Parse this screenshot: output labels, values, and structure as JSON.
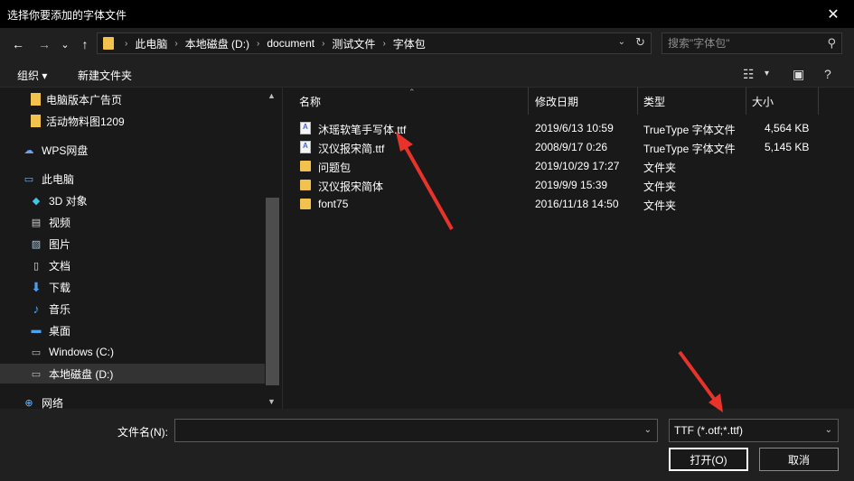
{
  "window": {
    "title": "选择你要添加的字体文件",
    "close_glyph": "✕"
  },
  "nav": {
    "back_glyph": "←",
    "forward_glyph": "→",
    "recent_glyph": "⌄",
    "up_glyph": "↑",
    "breadcrumbs": [
      "此电脑",
      "本地磁盘 (D:)",
      "document",
      "测试文件",
      "字体包"
    ],
    "search_placeholder": "搜索\"字体包\""
  },
  "toolbar": {
    "organize": "组织 ▾",
    "new_folder": "新建文件夹"
  },
  "sidebar": {
    "items": [
      {
        "label": "电脑版本广告页",
        "icon": "folder-icon",
        "indent": 1
      },
      {
        "label": "活动物料图1209",
        "icon": "folder-icon",
        "indent": 1
      },
      {
        "label": "WPS网盘",
        "icon": "cloud-icon",
        "indent": 0
      },
      {
        "label": "此电脑",
        "icon": "computer-icon",
        "indent": 0
      },
      {
        "label": "3D 对象",
        "icon": "cube-icon",
        "indent": 1
      },
      {
        "label": "视频",
        "icon": "video-icon",
        "indent": 1
      },
      {
        "label": "图片",
        "icon": "picture-icon",
        "indent": 1
      },
      {
        "label": "文档",
        "icon": "document-icon",
        "indent": 1
      },
      {
        "label": "下载",
        "icon": "download-icon",
        "indent": 1
      },
      {
        "label": "音乐",
        "icon": "music-icon",
        "indent": 1
      },
      {
        "label": "桌面",
        "icon": "desktop-icon",
        "indent": 1
      },
      {
        "label": "Windows (C:)",
        "icon": "drive-icon",
        "indent": 1
      },
      {
        "label": "本地磁盘 (D:)",
        "icon": "drive-icon",
        "indent": 1
      },
      {
        "label": "网络",
        "icon": "network-icon",
        "indent": 0
      }
    ]
  },
  "files": {
    "columns": {
      "name": "名称",
      "modified": "修改日期",
      "type": "类型",
      "size": "大小"
    },
    "rows": [
      {
        "name": "沐瑶软笔手写体.ttf",
        "modified": "2019/6/13 10:59",
        "type": "TrueType 字体文件",
        "size": "4,564 KB",
        "kind": "ttf"
      },
      {
        "name": "汉仪报宋简.ttf",
        "modified": "2008/9/17 0:26",
        "type": "TrueType 字体文件",
        "size": "5,145 KB",
        "kind": "ttf"
      },
      {
        "name": "问题包",
        "modified": "2019/10/29 17:27",
        "type": "文件夹",
        "size": "",
        "kind": "folder"
      },
      {
        "name": "汉仪报宋简体",
        "modified": "2019/9/9 15:39",
        "type": "文件夹",
        "size": "",
        "kind": "folder"
      },
      {
        "name": "font75",
        "modified": "2016/11/18 14:50",
        "type": "文件夹",
        "size": "",
        "kind": "folder"
      }
    ]
  },
  "bottom": {
    "filename_label": "文件名(N):",
    "filename_value": "",
    "filetype_value": "TTF (*.otf;*.ttf)",
    "open_label": "打开(O)",
    "cancel_label": "取消"
  },
  "colors": {
    "background": "#191919",
    "chrome": "#202020",
    "folder": "#f1c24e",
    "annotation_arrow": "#e8332a"
  }
}
